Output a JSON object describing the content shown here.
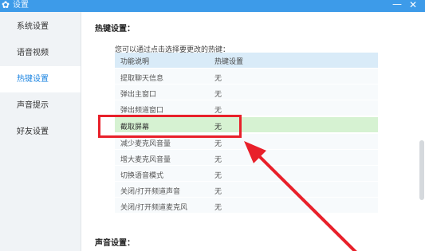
{
  "window": {
    "title": "设置",
    "minimize_icon": "minimize-icon",
    "close_icon": "close-icon"
  },
  "sidebar": {
    "items": [
      {
        "label": "系统设置"
      },
      {
        "label": "语音视频"
      },
      {
        "label": "热键设置"
      },
      {
        "label": "声音提示"
      },
      {
        "label": "好友设置"
      }
    ],
    "active_index": 2
  },
  "hotkeys": {
    "section_title": "热键设置：",
    "hint": "您可以通过点击选择要更改的热键：",
    "headers": [
      "功能说明",
      "热键设置"
    ],
    "rows": [
      {
        "name": "提取聊天信息",
        "key": "无"
      },
      {
        "name": "弹出主窗口",
        "key": "无"
      },
      {
        "name": "弹出频道窗口",
        "key": "无"
      },
      {
        "name": "截取屏幕",
        "key": "无"
      },
      {
        "name": "减少麦克风音量",
        "key": "无"
      },
      {
        "name": "增大麦克风音量",
        "key": "无"
      },
      {
        "name": "切换语音模式",
        "key": "无"
      },
      {
        "name": "关闭/打开频道声音",
        "key": "无"
      },
      {
        "name": "关闭/打开频道麦克风",
        "key": "无"
      }
    ],
    "selected_row": 3
  },
  "sound": {
    "section_title": "声音设置："
  },
  "colors": {
    "titlebar": "#3d9be9",
    "active": "#1e86e2",
    "selected_row": "#d6f2d2",
    "annotation": "#e8202a"
  }
}
